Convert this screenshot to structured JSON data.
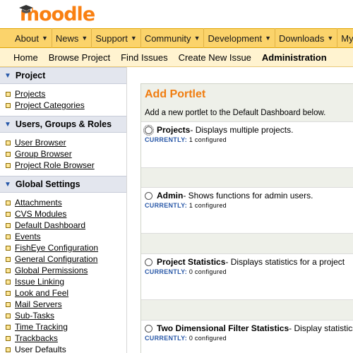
{
  "logo": {
    "text": "moodle"
  },
  "top_nav": [
    {
      "label": "About",
      "has_menu": true
    },
    {
      "label": "News",
      "has_menu": true
    },
    {
      "label": "Support",
      "has_menu": true
    },
    {
      "label": "Community",
      "has_menu": true
    },
    {
      "label": "Development",
      "has_menu": true
    },
    {
      "label": "Downloads",
      "has_menu": true
    },
    {
      "label": "My forums",
      "has_menu": false
    }
  ],
  "sub_nav": [
    {
      "label": "Home",
      "bold": false
    },
    {
      "label": "Browse Project",
      "bold": false
    },
    {
      "label": "Find Issues",
      "bold": false
    },
    {
      "label": "Create New Issue",
      "bold": false
    },
    {
      "label": "Administration",
      "bold": true
    }
  ],
  "sidebar": {
    "sections": [
      {
        "title": "Project",
        "links": [
          "Projects",
          "Project Categories"
        ]
      },
      {
        "title": "Users, Groups & Roles",
        "links": [
          "User Browser",
          "Group Browser",
          "Project Role Browser"
        ]
      },
      {
        "title": "Global Settings",
        "links": [
          "Attachments",
          "CVS Modules",
          "Default Dashboard",
          "Events",
          "FishEye Configuration",
          "General Configuration",
          "Global Permissions",
          "Issue Linking",
          "Look and Feel",
          "Mail Servers",
          "Sub-Tasks",
          "Time Tracking",
          "Trackbacks",
          "User Defaults"
        ]
      }
    ]
  },
  "main": {
    "title": "Add Portlet",
    "description": "Add a new portlet to the Default Dashboard below.",
    "currently_label": "CURRENTLY:",
    "portlets": [
      {
        "name": "Projects",
        "desc": " - Displays multiple projects.",
        "currently": "1 configured",
        "focused": true
      },
      {
        "name": "Admin",
        "desc": " - Shows functions for admin users.",
        "currently": "1 configured",
        "focused": false
      },
      {
        "name": "Project Statistics",
        "desc": " - Displays statistics for a project",
        "currently": "0 configured",
        "focused": false
      },
      {
        "name": "Two Dimensional Filter Statistics",
        "desc": " - Display statistics",
        "currently": "0 configured",
        "focused": false
      }
    ]
  },
  "colors": {
    "brand_orange": "#f98012",
    "nav_yellow": "#fbd36b",
    "subnav_cream": "#fff3d0",
    "portlet_title_orange": "#f07d10",
    "currently_blue": "#2a59a8"
  }
}
